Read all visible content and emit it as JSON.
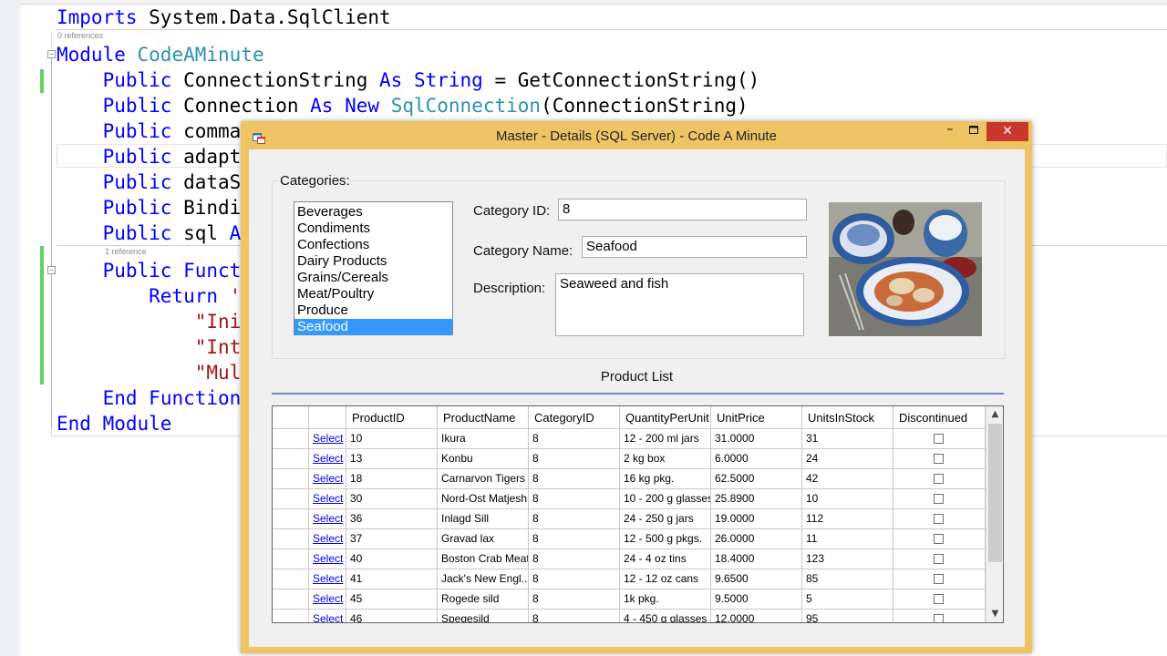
{
  "editor": {
    "codelens_top": "0 references",
    "codelens_mid": "1 reference",
    "lines": {
      "l1_kw": "Imports",
      "l1_rest": " System.Data.SqlClient",
      "l2_kw": "Module",
      "l2_type": "CodeAMinute",
      "l3_kw": "Public",
      "l3_a": " ConnectionString ",
      "l3_kw2": "As",
      "l3_type": "String",
      "l3_b": " = GetConnectionString()",
      "l4_kw": "Public",
      "l4_a": " Connection ",
      "l4_kw2": "As",
      "l4_kw3": "New",
      "l4_type": "SqlConnection",
      "l4_b": "(ConnectionString)",
      "l5_kw": "Public",
      "l5_a": " comma",
      "l6_kw": "Public",
      "l6_a": " adapt",
      "l7_kw": "Public",
      "l7_a": " dataS",
      "l8_kw": "Public",
      "l8_a": " Bindi",
      "l9_kw": "Public",
      "l9_a": " sql ",
      "l9_b": "A",
      "l10_kw": "Public",
      "l10_kw2": "Funct",
      "l11_kw": "Return",
      "l11_str": "'",
      "l12_str": "\"Ini",
      "l13_str": "\"Int",
      "l14_str": "\"Mul",
      "l15_kw": "End",
      "l15_kw2": "Function",
      "l16_kw": "End",
      "l16_kw2": "Module"
    }
  },
  "window": {
    "title": "Master - Details (SQL Server) - Code A Minute",
    "minimize_glyph": "–",
    "close_glyph": "✕",
    "categories_label": "Categories:",
    "categories": [
      "Beverages",
      "Condiments",
      "Confections",
      "Dairy Products",
      "Grains/Cereals",
      "Meat/Poultry",
      "Produce",
      "Seafood"
    ],
    "selected_category": "Seafood",
    "category_id_label": "Category ID:",
    "category_id_value": "8",
    "category_name_label": "Category Name:",
    "category_name_value": "Seafood",
    "description_label": "Description:",
    "description_value": "Seaweed and fish",
    "product_list_title": "Product List"
  },
  "grid": {
    "columns": [
      "",
      "",
      "ProductID",
      "ProductName",
      "CategoryID",
      "QuantityPerUnit",
      "UnitPrice",
      "UnitsInStock",
      "Discontinued"
    ],
    "select_label": "Select",
    "rows": [
      [
        "10",
        "Ikura",
        "8",
        "12 - 200 ml jars",
        "31.0000",
        "31"
      ],
      [
        "13",
        "Konbu",
        "8",
        "2 kg box",
        "6.0000",
        "24"
      ],
      [
        "18",
        "Carnarvon Tigers",
        "8",
        "16 kg pkg.",
        "62.5000",
        "42"
      ],
      [
        "30",
        "Nord-Ost Matjesh...",
        "8",
        "10 - 200 g glasses",
        "25.8900",
        "10"
      ],
      [
        "36",
        "Inlagd Sill",
        "8",
        "24 - 250 g  jars",
        "19.0000",
        "112"
      ],
      [
        "37",
        "Gravad lax",
        "8",
        "12 - 500 g pkgs.",
        "26.0000",
        "11"
      ],
      [
        "40",
        "Boston Crab Meat",
        "8",
        "24 - 4 oz tins",
        "18.4000",
        "123"
      ],
      [
        "41",
        "Jack's New Engl...",
        "8",
        "12 - 12 oz cans",
        "9.6500",
        "85"
      ],
      [
        "45",
        "Rogede sild",
        "8",
        "1k pkg.",
        "9.5000",
        "5"
      ],
      [
        "46",
        "Spegesild",
        "8",
        "4 - 450 g glasses",
        "12.0000",
        "95"
      ]
    ],
    "discontinued": [
      false,
      false,
      false,
      false,
      false,
      false,
      false,
      false,
      false,
      false
    ]
  },
  "colors": {
    "window_frame": "#efc465",
    "close_button": "#c7382b",
    "selection": "#3399ff",
    "keyword": "#0000ff",
    "type": "#2b91af",
    "string": "#a31515"
  }
}
